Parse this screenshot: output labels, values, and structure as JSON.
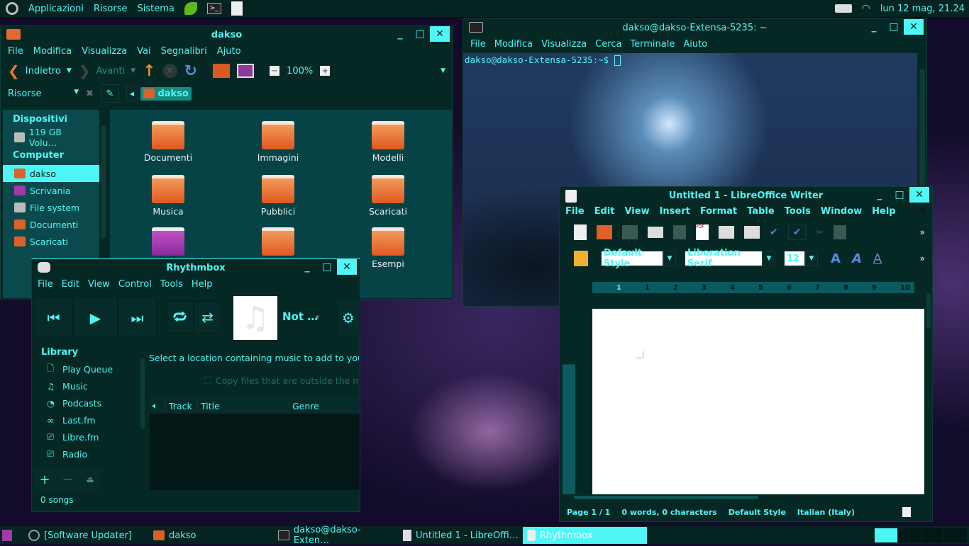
{
  "top_panel": {
    "menus": [
      "Applicazioni",
      "Risorse",
      "Sistema"
    ],
    "clock": "lun 12 mag, 21.24"
  },
  "nautilus": {
    "title": "dakso",
    "menus": [
      "File",
      "Modifica",
      "Visualizza",
      "Vai",
      "Segnalibri",
      "Ajuto"
    ],
    "back": "Indietro",
    "forward": "Avanti",
    "zoom": "100%",
    "places_label": "Risorse",
    "path": "dakso",
    "sidebar": {
      "devices_header": "Dispositivi",
      "devices": [
        "119 GB Volu…"
      ],
      "computer_header": "Computer",
      "computer": [
        "dakso",
        "Scrivania",
        "File system",
        "Documenti",
        "Scaricati"
      ]
    },
    "folders": [
      "Documenti",
      "Immagini",
      "Modelli",
      "Musica",
      "Pubblici",
      "Scaricati",
      "",
      "",
      "Esempi"
    ]
  },
  "terminal": {
    "title": "dakso@dakso-Extensa-5235: ~",
    "menus": [
      "File",
      "Modifica",
      "Visualizza",
      "Cerca",
      "Terminale",
      "Aiuto"
    ],
    "prompt": "dakso@dakso-Extensa-5235:~$"
  },
  "writer": {
    "title": "Untitled 1 - LibreOffice Writer",
    "menus": [
      "File",
      "Edit",
      "View",
      "Insert",
      "Format",
      "Table",
      "Tools",
      "Window",
      "Help"
    ],
    "para_style": "Default Style",
    "font": "Liberation Serif",
    "size": "12",
    "ruler": [
      "1",
      "1",
      "2",
      "3",
      "4",
      "5",
      "6",
      "7",
      "8",
      "9",
      "10"
    ],
    "status": {
      "page": "Page 1 / 1",
      "words": "0 words, 0 characters",
      "style": "Default Style",
      "lang": "Italian (Italy)"
    }
  },
  "rhythmbox": {
    "title": "Rhythmbox",
    "menus": [
      "File",
      "Edit",
      "View",
      "Control",
      "Tools",
      "Help"
    ],
    "now_playing": "Not …",
    "library_header": "Library",
    "library": [
      {
        "icon": "page-icon",
        "label": "Play Queue"
      },
      {
        "icon": "music-icon",
        "label": "Music"
      },
      {
        "icon": "rss-icon",
        "label": "Podcasts"
      },
      {
        "icon": "lastfm-icon",
        "label": "Last.fm"
      },
      {
        "icon": "radio-icon",
        "label": "Libre.fm"
      },
      {
        "icon": "radio-icon",
        "label": "Radio"
      }
    ],
    "message": "Select a location containing music to add to your",
    "copy_label": "Copy files that are outside the m",
    "columns": [
      "Track",
      "Title",
      "Genre"
    ],
    "status": "0 songs"
  },
  "taskbar": {
    "items": [
      "[Software Updater]",
      "dakso",
      "dakso@dakso-Exten…",
      "Untitled 1 - LibreOffi…",
      "Rhythmbox"
    ]
  },
  "colors": {
    "accent": "#4ff6f6",
    "window_bg": "#062824"
  }
}
